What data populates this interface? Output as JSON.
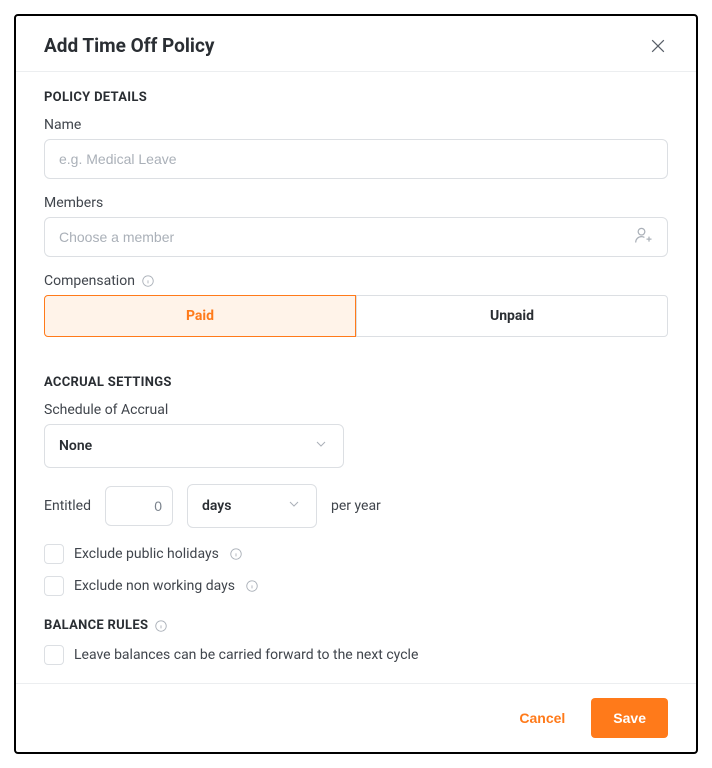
{
  "modal": {
    "title": "Add Time Off Policy"
  },
  "policy_details": {
    "section_title": "POLICY DETAILS",
    "name_label": "Name",
    "name_placeholder": "e.g. Medical Leave",
    "members_label": "Members",
    "members_placeholder": "Choose a member",
    "compensation_label": "Compensation",
    "comp_paid": "Paid",
    "comp_unpaid": "Unpaid"
  },
  "accrual": {
    "section_title": "ACCRUAL SETTINGS",
    "schedule_label": "Schedule of Accrual",
    "schedule_value": "None",
    "entitled_label": "Entitled",
    "entitled_value": "0",
    "unit_value": "days",
    "per_year": "per year",
    "exclude_holidays": "Exclude public holidays",
    "exclude_nonworking": "Exclude non working days"
  },
  "balance": {
    "section_title": "BALANCE RULES",
    "carry_forward": "Leave balances can be carried forward to the next cycle"
  },
  "footer": {
    "cancel": "Cancel",
    "save": "Save"
  }
}
